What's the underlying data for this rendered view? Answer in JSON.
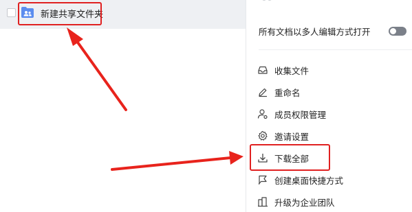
{
  "file_list": {
    "rows": [
      {
        "name": "新建共享文件夹",
        "icon": "shared-folder-icon"
      }
    ]
  },
  "panel": {
    "toggle_label": "所有文档以多人编辑方式打开",
    "toggle_state": "off",
    "menu": [
      {
        "label": "收集文件",
        "icon": "inbox-icon"
      },
      {
        "label": "重命名",
        "icon": "pencil-icon"
      },
      {
        "label": "成员权限管理",
        "icon": "user-settings-icon"
      },
      {
        "label": "邀请设置",
        "icon": "gear-icon"
      },
      {
        "label": "下载全部",
        "icon": "download-icon"
      },
      {
        "label": "创建桌面快捷方式",
        "icon": "shortcut-icon"
      },
      {
        "label": "升级为企业团队",
        "icon": "building-icon"
      }
    ]
  },
  "colors": {
    "annotation": "#e02020",
    "folder": "#5b8def",
    "selected_row": "#eef0f3",
    "toggle_off": "#7b8089"
  }
}
